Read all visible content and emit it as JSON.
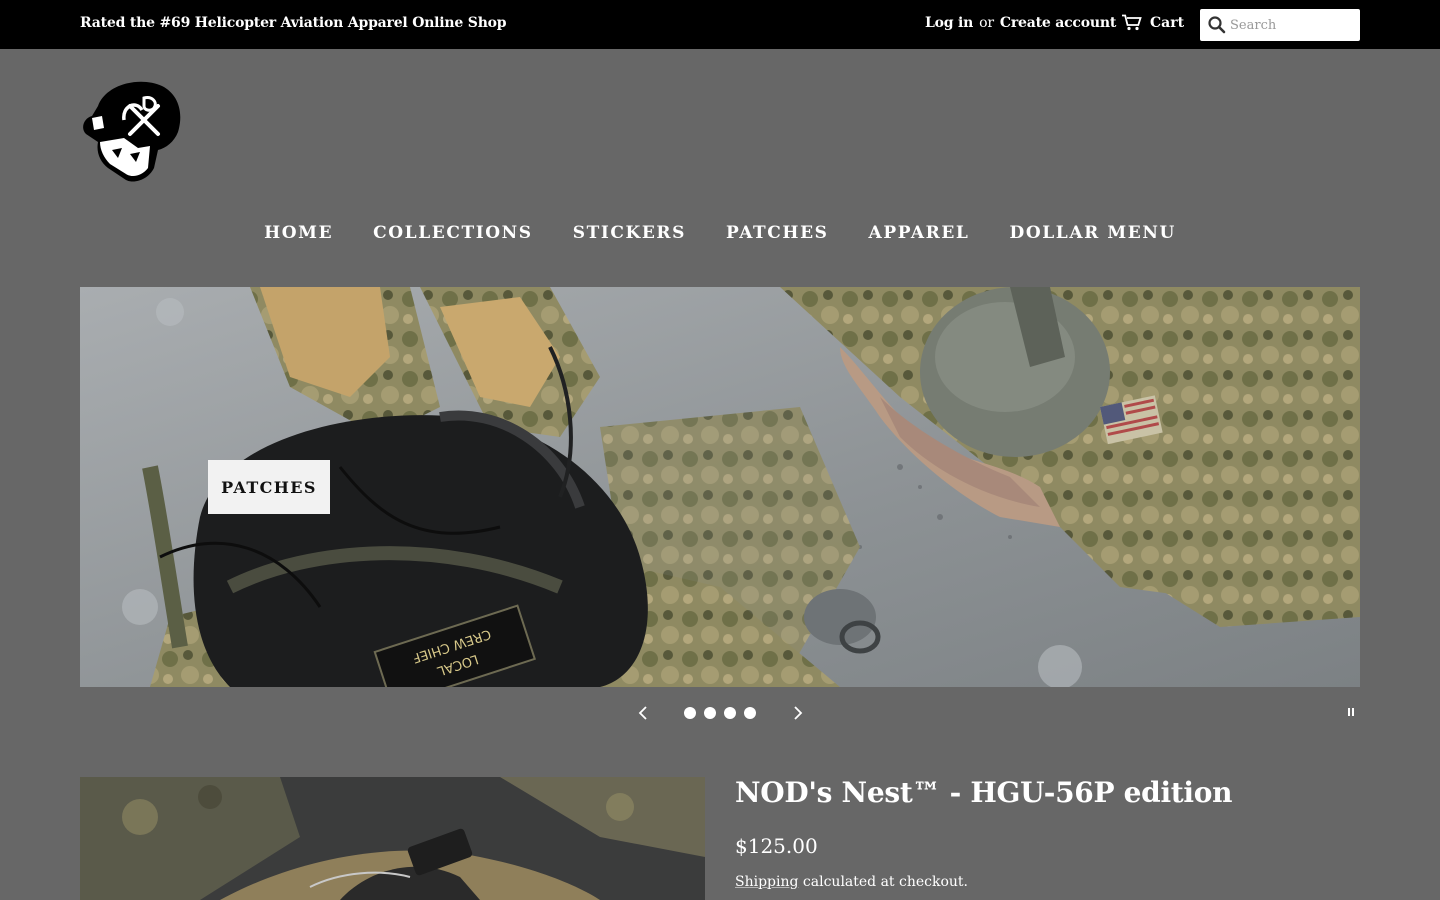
{
  "topbar": {
    "tagline": "Rated the #69 Helicopter Aviation Apparel Online Shop",
    "login": "Log in",
    "or": "or",
    "create_account": "Create account",
    "cart": "Cart",
    "search_placeholder": "Search"
  },
  "nav": {
    "items": [
      "HOME",
      "COLLECTIONS",
      "STICKERS",
      "PATCHES",
      "APPAREL",
      "DOLLAR MENU"
    ]
  },
  "hero": {
    "slide_label": "PATCHES",
    "slide_count": 4,
    "helmet_patch_text": "SUPPORT LOCAL CREW CHIEF"
  },
  "product": {
    "title": "NOD's Nest™ - HGU-56P edition",
    "price": "$125.00",
    "shipping_link": "Shipping",
    "shipping_rest": " calculated at checkout."
  },
  "icons": {
    "cart": "cart-icon",
    "search": "search-icon",
    "prev": "chevron-left-icon",
    "next": "chevron-right-icon",
    "pause": "pause-icon"
  }
}
